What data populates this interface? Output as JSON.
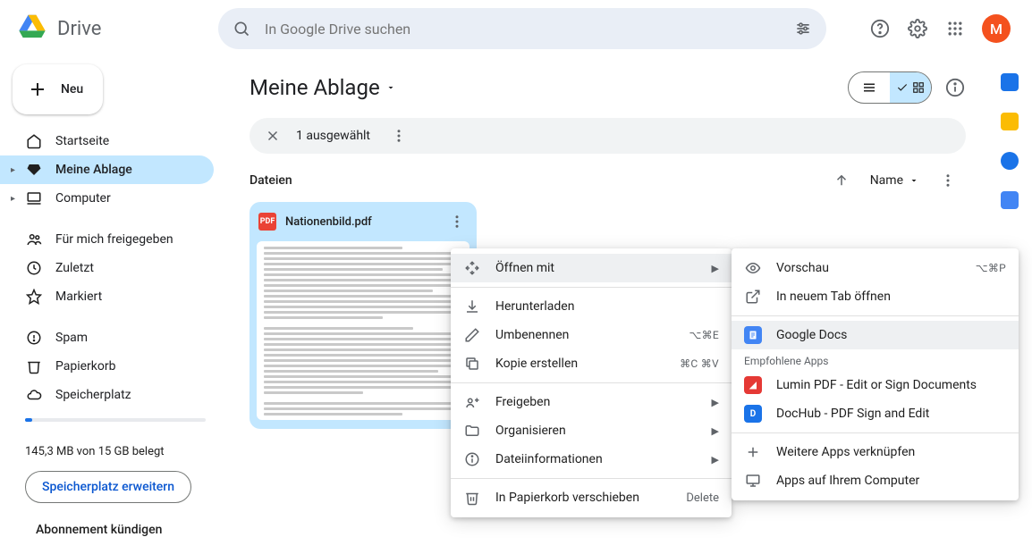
{
  "header": {
    "product_name": "Drive",
    "search_placeholder": "In Google Drive suchen",
    "avatar_initial": "M"
  },
  "sidebar": {
    "new_button": "Neu",
    "items": [
      {
        "label": "Startseite"
      },
      {
        "label": "Meine Ablage"
      },
      {
        "label": "Computer"
      },
      {
        "label": "Für mich freigegeben"
      },
      {
        "label": "Zuletzt"
      },
      {
        "label": "Markiert"
      },
      {
        "label": "Spam"
      },
      {
        "label": "Papierkorb"
      },
      {
        "label": "Speicherplatz"
      }
    ],
    "storage_text": "145,3 MB von 15 GB belegt",
    "storage_button": "Speicherplatz erweitern",
    "cancel_subscription": "Abonnement kündigen"
  },
  "main": {
    "page_title": "Meine Ablage",
    "selection_text": "1 ausgewählt",
    "files_heading": "Dateien",
    "sort_label": "Name",
    "file": {
      "name": "Nationenbild.pdf",
      "type_badge": "PDF"
    }
  },
  "context_menu": {
    "open_with": "Öffnen mit",
    "download": "Herunterladen",
    "rename": "Umbenennen",
    "rename_shortcut": "⌥⌘E",
    "make_copy": "Kopie erstellen",
    "make_copy_shortcut": "⌘C ⌘V",
    "share": "Freigeben",
    "organise": "Organisieren",
    "file_info": "Dateiinformationen",
    "trash": "In Papierkorb verschieben",
    "trash_action": "Delete"
  },
  "open_with_menu": {
    "preview": "Vorschau",
    "preview_shortcut": "⌥⌘P",
    "new_tab": "In neuem Tab öffnen",
    "google_docs": "Google Docs",
    "recommended_heading": "Empfohlene Apps",
    "lumin": "Lumin PDF - Edit or Sign Documents",
    "dochub": "DocHub - PDF Sign and Edit",
    "connect_more": "Weitere Apps verknüpfen",
    "on_computer": "Apps auf Ihrem Computer"
  }
}
